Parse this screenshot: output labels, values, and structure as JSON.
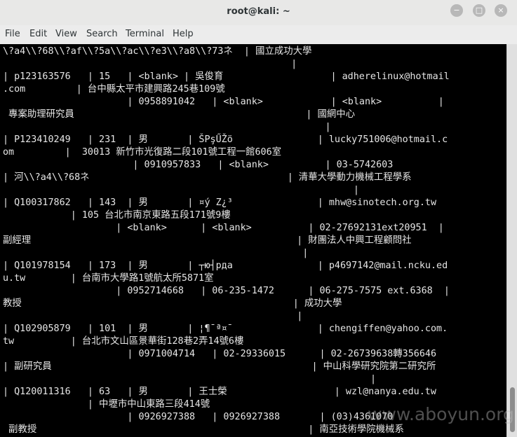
{
  "window": {
    "title": "root@kali: ~",
    "controls": {
      "minimize": "−",
      "maximize": "□",
      "close": "×"
    }
  },
  "menubar": {
    "items": [
      "File",
      "Edit",
      "View",
      "Search",
      "Terminal",
      "Help"
    ]
  },
  "terminal": {
    "lines": [
      "\\?a4\\\\?68\\\\?af\\\\?5a\\\\?ac\\\\?e3\\\\?a8\\\\?73ネ  | 國立成功大學",
      "                                                   |",
      "| p123163576   | 15   | <blank> | 吳俊育                   | adherelinux@hotmail",
      ".com         | 台中縣太平市建興路245巷109號",
      "                      | 0958891042   | <blank>            | <blank>          |",
      " 專案助理研究員                                         | 國網中心",
      "                                                         |",
      "| P123410249   | 231  | 男       | ŠPşŰŽö               | lucky751006@hotmail.c",
      "om         |  30013 新竹市光復路二段101號工程一館606室",
      "                       | 0910957833   | <blank>          | 03-5742603",
      "| 河\\\\?a4\\\\?68ネ                                   | 清華大學動力機械工程學系",
      "                                                              |",
      "| Q100317862   | 143  | 男       | ¤ý Z¿³               | mhw@sinotech.org.tw",
      "            | 105 台北市南京東路五段171號9樓",
      "                    | <blank>      | <blank>          | 02-27692131ext20951  |",
      "副經理                                               | 財團法人中興工程顧問社",
      "                                                     |",
      "| Q101978154   | 173  | 男       | ┬ю┤рда               | p4697142@mail.ncku.ed",
      "u.tw        | 台南市大學路1號航太所5871室",
      "                    | 0952714668   | 06-235-1472      | 06-275-7575 ext.6368  |",
      "教授                                                | 成功大學",
      "                                                    |",
      "| Q102905879   | 101  | 男       | ¦¶¯ª¤¯               | chengiffen@yahoo.com.",
      "tw          | 台北市文山區景華街128巷2弄14號6樓",
      "                      | 0971004714   | 02-29336015      | 02-26739638轉356646",
      "| 副研究員                                              | 中山科學研究院第二研究所",
      "                                                                 |",
      "| Q120011316   | 63   | 男       | 王士榮                   | wzl@nanya.edu.tw",
      "               | 中壢市中山東路三段414號",
      "                      | 0926927388   | 0926927388       | (03)4361070",
      " 副教授                                                | 南亞技術學院機械系"
    ]
  },
  "watermark": "www.aboyun.org"
}
